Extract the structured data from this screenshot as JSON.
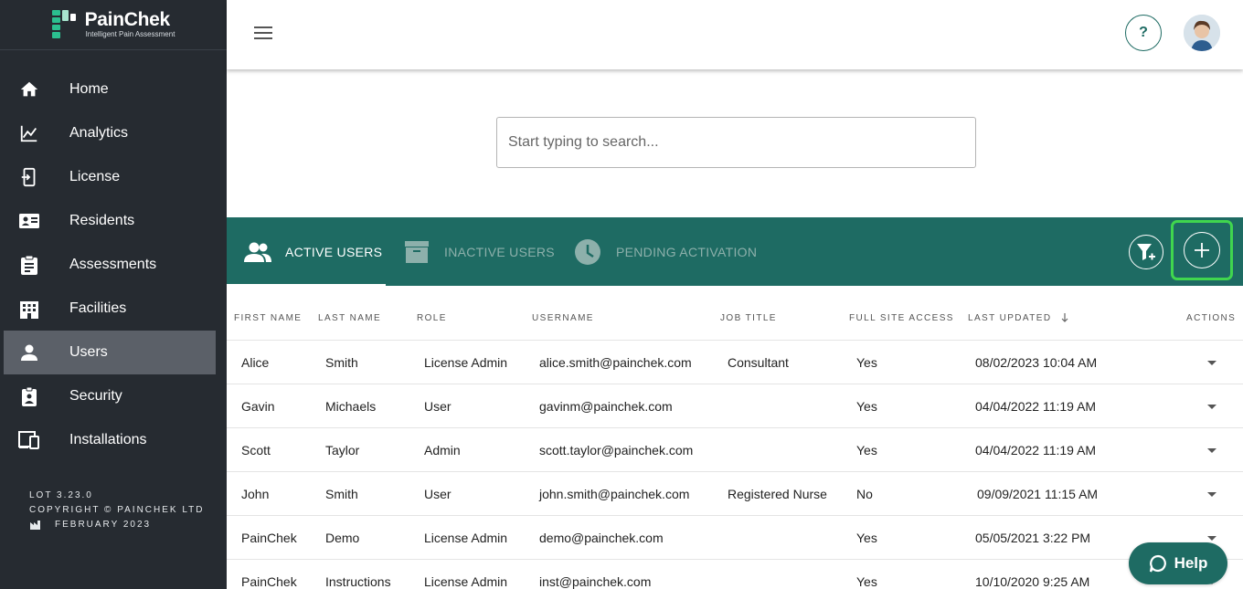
{
  "brand": {
    "name": "PainChek",
    "tagline": "Intelligent Pain Assessment"
  },
  "sidebar": {
    "items": [
      {
        "label": "Home",
        "icon": "home-icon"
      },
      {
        "label": "Analytics",
        "icon": "analytics-icon"
      },
      {
        "label": "License",
        "icon": "license-icon"
      },
      {
        "label": "Residents",
        "icon": "residents-icon"
      },
      {
        "label": "Assessments",
        "icon": "assessments-icon"
      },
      {
        "label": "Facilities",
        "icon": "facilities-icon"
      },
      {
        "label": "Users",
        "icon": "users-icon",
        "active": true
      },
      {
        "label": "Security",
        "icon": "security-icon"
      },
      {
        "label": "Installations",
        "icon": "installations-icon"
      }
    ],
    "version": "LOT 3.23.0",
    "copyright": "COPYRIGHT © PAINCHEK LTD",
    "release_date": "FEBRUARY 2023"
  },
  "header": {
    "help_label": "?"
  },
  "search": {
    "placeholder": "Start typing to search..."
  },
  "tabs": [
    {
      "label": "ACTIVE USERS",
      "active": true
    },
    {
      "label": "INACTIVE USERS",
      "active": false
    },
    {
      "label": "PENDING ACTIVATION",
      "active": false
    }
  ],
  "table": {
    "columns": [
      "FIRST NAME",
      "LAST NAME",
      "ROLE",
      "USERNAME",
      "JOB TITLE",
      "FULL SITE ACCESS",
      "LAST UPDATED",
      "ACTIONS"
    ],
    "sort_column": "LAST UPDATED",
    "rows": [
      [
        "Alice",
        "Smith",
        "License Admin",
        "alice.smith@painchek.com",
        "Consultant",
        "Yes",
        "08/02/2023 10:04 AM"
      ],
      [
        "Gavin",
        "Michaels",
        "User",
        "gavinm@painchek.com",
        "",
        "Yes",
        "04/04/2022 11:19 AM"
      ],
      [
        "Scott",
        "Taylor",
        "Admin",
        "scott.taylor@painchek.com",
        "",
        "Yes",
        "04/04/2022 11:19 AM"
      ],
      [
        "John",
        "Smith",
        "User",
        "john.smith@painchek.com",
        "Registered Nurse",
        "No",
        "09/09/2021 11:15 AM"
      ],
      [
        "PainChek",
        "Demo",
        "License Admin",
        "demo@painchek.com",
        "",
        "Yes",
        "05/05/2021 3:22 PM"
      ],
      [
        "PainChek",
        "Instructions",
        "License Admin",
        "inst@painchek.com",
        "",
        "Yes",
        "10/10/2020 9:25 AM"
      ]
    ]
  },
  "help_button": {
    "label": "Help"
  },
  "colors": {
    "sidebar_bg": "#262b31",
    "teal": "#1e6b63",
    "highlight_green": "#40d64e",
    "active_nav": "#5b6068"
  }
}
